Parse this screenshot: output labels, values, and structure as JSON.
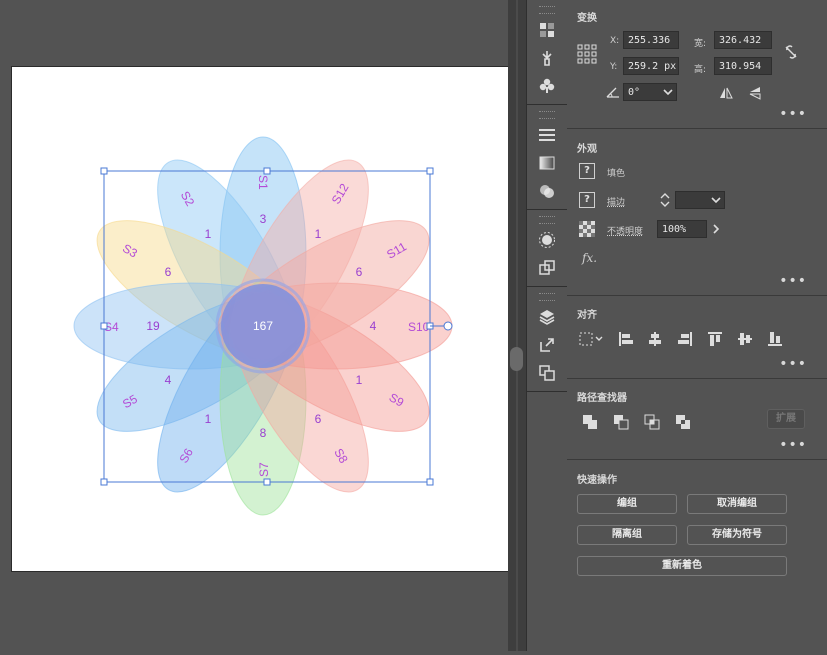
{
  "canvas": {
    "labels": {
      "S1": "S1",
      "S2": "S2",
      "S3": "S3",
      "S4": "S4",
      "S5": "S5",
      "S6": "S6",
      "S7": "S7",
      "S8": "S8",
      "S9": "S9",
      "S10": "S10",
      "S11": "S11",
      "S12": "S12"
    },
    "counts": {
      "center": "167",
      "c_top": "3",
      "c_top_left": "1",
      "c_top_right": "1",
      "c_left_upper": "6",
      "c_right_upper": "6",
      "c_left": "19",
      "c_right": "4",
      "c_left_lower": "4",
      "c_right_lower": "1",
      "c_bottom_left": "1",
      "c_bottom": "8",
      "c_bottom_right": "6"
    },
    "colors": {
      "label": "#b44bd6",
      "selection": "#4a78d4"
    }
  },
  "transform": {
    "title": "变换",
    "x_label": "X:",
    "x_value": "255.336",
    "y_label": "Y:",
    "y_value": "259.2 px",
    "w_label": "宽:",
    "w_value": "326.432",
    "h_label": "高:",
    "h_value": "310.954",
    "angle_value": "0°"
  },
  "appearance": {
    "title": "外观",
    "fill_label": "填色",
    "stroke_label": "描边",
    "opacity_label": "不透明度",
    "opacity_value": "100%",
    "fx_label": "fx."
  },
  "align": {
    "title": "对齐"
  },
  "pathfinder": {
    "title": "路径查找器",
    "expand_label": "扩展"
  },
  "quick_actions": {
    "title": "快速操作",
    "group": "编组",
    "ungroup": "取消编组",
    "isolate": "隔离组",
    "save_symbol": "存储为符号",
    "recolor": "重新着色"
  }
}
